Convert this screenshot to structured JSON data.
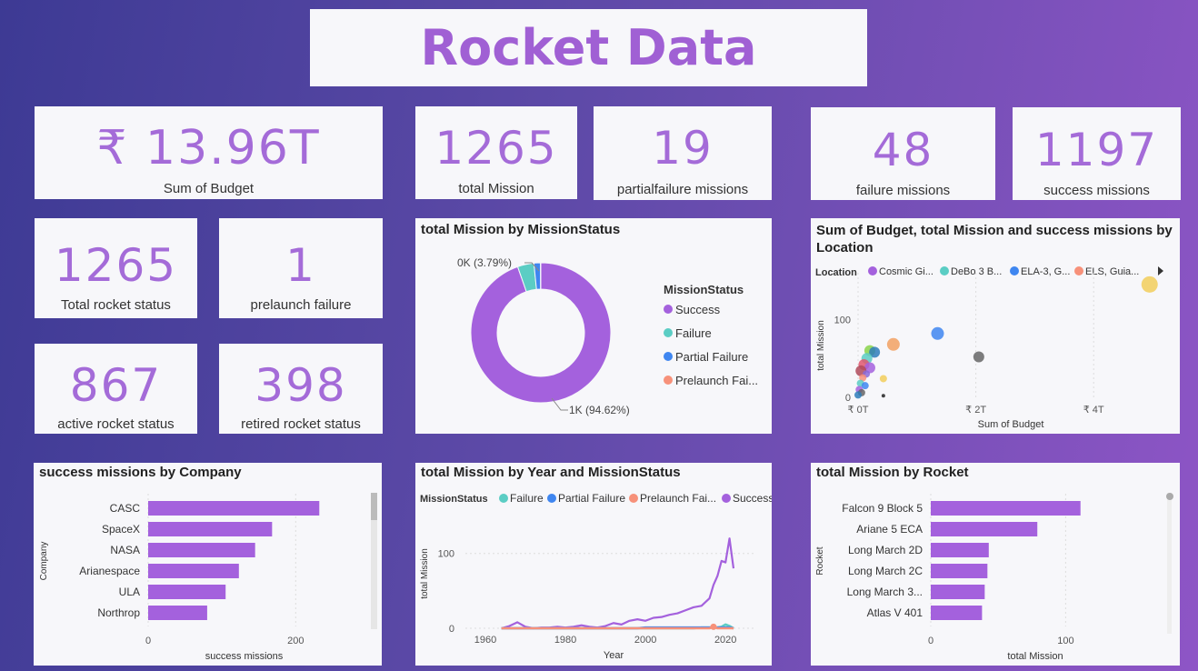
{
  "title": "Rocket Data",
  "kpis": {
    "budget": {
      "value": "₹ 13.96T",
      "label": "Sum of Budget"
    },
    "total_mission": {
      "value": "1265",
      "label": "total Mission"
    },
    "partial": {
      "value": "19",
      "label": "partialfailure missions"
    },
    "failure": {
      "value": "48",
      "label": "failure missions"
    },
    "success": {
      "value": "1197",
      "label": "success missions"
    },
    "rocket_status": {
      "value": "1265",
      "label": "Total rocket status"
    },
    "prelaunch": {
      "value": "1",
      "label": "prelaunch failure"
    },
    "active": {
      "value": "867",
      "label": "active rocket status"
    },
    "retired": {
      "value": "398",
      "label": "retired rocket status"
    }
  },
  "colors": {
    "success": "#a461dd",
    "failure": "#5bcdc4",
    "partial": "#3f86f0",
    "prelaunch": "#f7917a",
    "card": "#f7f7fa"
  },
  "chart_data": [
    {
      "id": "donut",
      "type": "pie",
      "title": "total Mission by MissionStatus",
      "legend_title": "MissionStatus",
      "categories": [
        "Success",
        "Failure",
        "Partial Failure",
        "Prelaunch Fai..."
      ],
      "values": [
        1197,
        48,
        19,
        1
      ],
      "data_labels": [
        "1K (94.62%)",
        "0K (3.79%)"
      ]
    },
    {
      "id": "scatter",
      "type": "scatter",
      "title": "Sum of Budget, total Mission and success missions by Location",
      "legend_title": "Location",
      "legend": [
        "Cosmic Gi...",
        "DeBo 3 B...",
        "ELA-3, G...",
        "ELS, Guia..."
      ],
      "xlabel": "Sum of Budget",
      "ylabel": "total Mission",
      "xticks": [
        "₹ 0T",
        "₹ 2T",
        "₹ 4T"
      ],
      "yticks": [
        "0",
        "100"
      ],
      "xlim": [
        0,
        5
      ],
      "ylim": [
        0,
        160
      ],
      "points": [
        {
          "x": 4.95,
          "y": 145,
          "c": "#f2ce5a"
        },
        {
          "x": 1.35,
          "y": 82,
          "c": "#3f86f0"
        },
        {
          "x": 2.05,
          "y": 52,
          "c": "#666666"
        },
        {
          "x": 0.6,
          "y": 68,
          "c": "#f2a162"
        },
        {
          "x": 0.2,
          "y": 60,
          "c": "#8ad34a"
        },
        {
          "x": 0.28,
          "y": 58,
          "c": "#2e7dba"
        },
        {
          "x": 0.15,
          "y": 50,
          "c": "#5bcdc4"
        },
        {
          "x": 0.1,
          "y": 42,
          "c": "#e0566f"
        },
        {
          "x": 0.2,
          "y": 38,
          "c": "#a461dd"
        },
        {
          "x": 0.05,
          "y": 34,
          "c": "#b04a5a"
        },
        {
          "x": 0.14,
          "y": 30,
          "c": "#8a6ad8"
        },
        {
          "x": 0.08,
          "y": 25,
          "c": "#f7917a"
        },
        {
          "x": 0.43,
          "y": 24,
          "c": "#f2ce5a"
        },
        {
          "x": 0.04,
          "y": 18,
          "c": "#5bcdc4"
        },
        {
          "x": 0.12,
          "y": 15,
          "c": "#3f86f0"
        },
        {
          "x": 0.02,
          "y": 10,
          "c": "#a461dd"
        },
        {
          "x": 0.06,
          "y": 6,
          "c": "#666666"
        },
        {
          "x": 0.0,
          "y": 3,
          "c": "#2e7dba"
        },
        {
          "x": 0.43,
          "y": 2,
          "c": "#222222"
        }
      ]
    },
    {
      "id": "company",
      "type": "bar",
      "title": "success missions by Company",
      "xlabel": "success missions",
      "ylabel": "Company",
      "categories": [
        "CASC",
        "SpaceX",
        "NASA",
        "Arianespace",
        "ULA",
        "Northrop"
      ],
      "values": [
        232,
        168,
        145,
        123,
        105,
        80
      ],
      "xlim": [
        0,
        260
      ],
      "xticks": [
        "0",
        "200"
      ]
    },
    {
      "id": "year",
      "type": "line",
      "title": "total Mission by Year and MissionStatus",
      "legend_title": "MissionStatus",
      "xlabel": "Year",
      "ylabel": "total Mission",
      "xlim": [
        1955,
        2027
      ],
      "ylim": [
        0,
        130
      ],
      "xticks": [
        "1960",
        "1980",
        "2000",
        "2020"
      ],
      "yticks": [
        "0",
        "100"
      ],
      "x": [
        1964,
        1966,
        1968,
        1970,
        1972,
        1974,
        1976,
        1978,
        1980,
        1982,
        1984,
        1986,
        1988,
        1990,
        1992,
        1994,
        1996,
        1998,
        2000,
        2002,
        2004,
        2006,
        2008,
        2010,
        2012,
        2014,
        2016,
        2017,
        2018,
        2019,
        2020,
        2021,
        2022
      ],
      "series": [
        {
          "name": "Failure",
          "color": "#5bcdc4",
          "values": [
            0,
            0,
            0,
            0,
            0,
            0,
            0,
            0,
            0,
            0,
            0,
            0,
            0,
            0,
            0,
            0,
            0,
            0,
            0,
            0,
            0,
            0,
            0,
            0,
            0,
            1,
            1,
            1,
            1,
            2,
            5,
            3,
            0
          ]
        },
        {
          "name": "Partial Failure",
          "color": "#3f86f0",
          "values": [
            0,
            0,
            0,
            0,
            0,
            0,
            0,
            0,
            0,
            0,
            0,
            0,
            0,
            0,
            0,
            0,
            0,
            0,
            1,
            1,
            1,
            1,
            1,
            1,
            1,
            1,
            1,
            1,
            1,
            1,
            1,
            1,
            0
          ]
        },
        {
          "name": "Prelaunch Fai...",
          "color": "#f7917a",
          "values": [
            0,
            0,
            0,
            0,
            0,
            0,
            0,
            0,
            0,
            0,
            0,
            0,
            0,
            0,
            0,
            0,
            0,
            0,
            0,
            0,
            0,
            0,
            0,
            0,
            0,
            0,
            0,
            2,
            0,
            0,
            0,
            0,
            0
          ]
        },
        {
          "name": "Success",
          "color": "#a461dd",
          "values": [
            0,
            3,
            8,
            2,
            0,
            1,
            1,
            2,
            1,
            2,
            4,
            2,
            1,
            3,
            7,
            5,
            10,
            12,
            10,
            14,
            15,
            18,
            20,
            24,
            28,
            30,
            40,
            58,
            70,
            90,
            88,
            120,
            80
          ]
        }
      ]
    },
    {
      "id": "rocket",
      "type": "bar",
      "title": "total Mission by Rocket",
      "xlabel": "total Mission",
      "ylabel": "Rocket",
      "categories": [
        "Falcon 9 Block 5",
        "Ariane 5 ECA",
        "Long March 2D",
        "Long March 2C",
        "Long March 3...",
        "Atlas V 401"
      ],
      "values": [
        111,
        79,
        43,
        42,
        40,
        38
      ],
      "xlim": [
        0,
        155
      ],
      "xticks": [
        "0",
        "100"
      ]
    }
  ]
}
